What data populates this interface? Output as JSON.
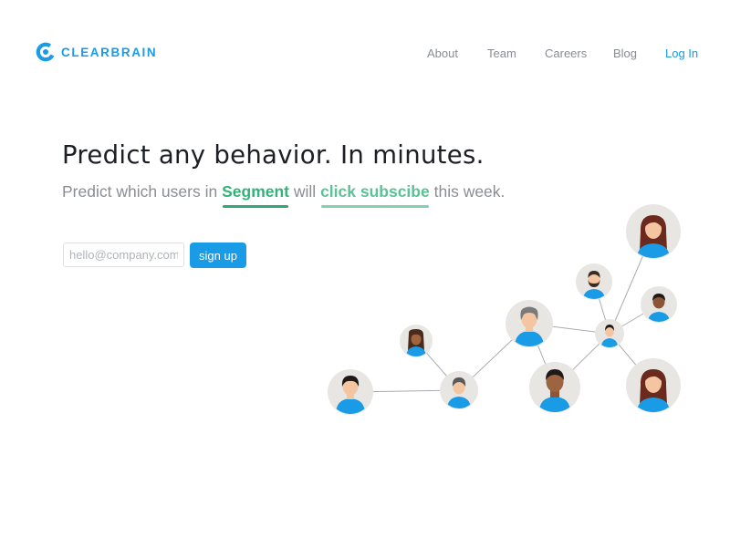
{
  "header": {
    "logo_text": "CLEARBRAIN",
    "brand_color": "#1a9be6",
    "nav": [
      {
        "label": "About",
        "icon": null
      },
      {
        "label": "Team"
      },
      {
        "label": "Careers"
      },
      {
        "label": "Blog"
      },
      {
        "label": "Log In"
      }
    ]
  },
  "hero": {
    "title": "Predict any behavior. In minutes.",
    "subtitle_prefix": "Predict which users in",
    "highlight_1": "Segment",
    "subtitle_mid": "will",
    "highlight_2": "click subscibe",
    "subtitle_suffix": "this week.",
    "highlight_color": "#34b27a"
  },
  "signup": {
    "placeholder": "hello@company.com",
    "button_label": "sign up"
  },
  "illustration": {
    "description_icon": "user-network-icon"
  }
}
